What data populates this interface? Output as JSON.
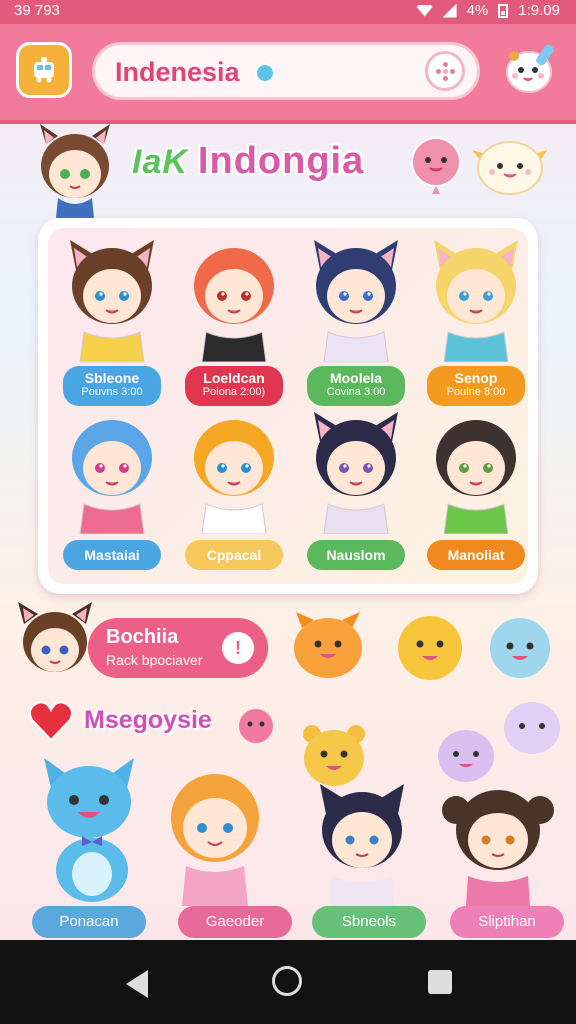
{
  "status_bar": {
    "time": "39 793",
    "battery": "4%",
    "clock": "1:9.09"
  },
  "header": {
    "search_value": "Indenesia"
  },
  "banner": {
    "logo_text": "IaK",
    "title": "Indongia"
  },
  "grid": [
    {
      "name": "Sbleone",
      "sub": "Pouvns 3:00",
      "color": "#4aa6e3"
    },
    {
      "name": "Loeldcan",
      "sub": "Poiona 2:00)",
      "color": "#e0364f"
    },
    {
      "name": "Moolela",
      "sub": "Covina 3:00",
      "color": "#5cb85c"
    },
    {
      "name": "Senop",
      "sub": "Poulne 8:00",
      "color": "#f39a1f"
    },
    {
      "name": "Mastaiai",
      "color": "#4aa6e3"
    },
    {
      "name": "Cppacal",
      "color": "#f5c85c"
    },
    {
      "name": "Nauslom",
      "color": "#5cb85c"
    },
    {
      "name": "Manoliat",
      "color": "#f08a1f"
    }
  ],
  "promo": {
    "title": "Bochiia",
    "subtitle": "Rack bpociaver",
    "badge": "!"
  },
  "section": {
    "title": "Msegoysie"
  },
  "bottom": [
    {
      "name": "Ponacan",
      "color": "#5aa8dc"
    },
    {
      "name": "Gaeoder",
      "color": "#e86a98"
    },
    {
      "name": "Sbneols",
      "color": "#66c078"
    },
    {
      "name": "Sliptihan",
      "color": "#ef7fb7"
    }
  ]
}
